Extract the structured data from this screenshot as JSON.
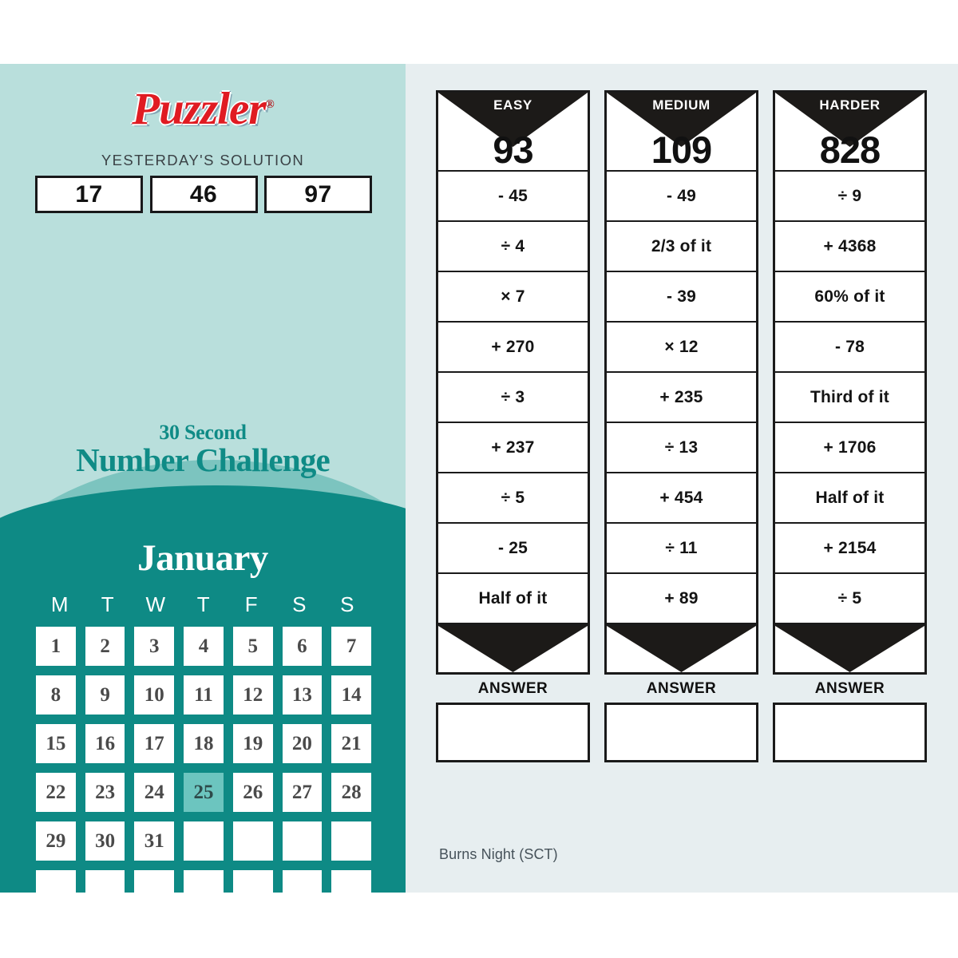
{
  "brand": {
    "logo_text": "Puzzler",
    "registered_mark": "®"
  },
  "yesterday": {
    "label": "YESTERDAY'S SOLUTION",
    "values": [
      "17",
      "46",
      "97"
    ]
  },
  "challenge": {
    "line1": "30 Second",
    "line2": "Number Challenge"
  },
  "calendar": {
    "month": "January",
    "day_headers": [
      "M",
      "T",
      "W",
      "T",
      "F",
      "S",
      "S"
    ],
    "weeks": [
      [
        "1",
        "2",
        "3",
        "4",
        "5",
        "6",
        "7"
      ],
      [
        "8",
        "9",
        "10",
        "11",
        "12",
        "13",
        "14"
      ],
      [
        "15",
        "16",
        "17",
        "18",
        "19",
        "20",
        "21"
      ],
      [
        "22",
        "23",
        "24",
        "25",
        "26",
        "27",
        "28"
      ],
      [
        "29",
        "30",
        "31",
        "",
        "",
        "",
        ""
      ],
      [
        "",
        "",
        "",
        "",
        "",
        "",
        ""
      ]
    ],
    "highlighted_day": "25",
    "highlight_color": "#6cc5bf"
  },
  "puzzles": [
    {
      "difficulty": "EASY",
      "start": "93",
      "steps": [
        "- 45",
        "÷ 4",
        "× 7",
        "+ 270",
        "÷ 3",
        "+ 237",
        "÷ 5",
        "- 25",
        "Half of it"
      ],
      "answer_label": "ANSWER",
      "answer_value": ""
    },
    {
      "difficulty": "MEDIUM",
      "start": "109",
      "steps": [
        "- 49",
        "2/3 of it",
        "- 39",
        "× 12",
        "+ 235",
        "÷ 13",
        "+ 454",
        "÷ 11",
        "+ 89"
      ],
      "answer_label": "ANSWER",
      "answer_value": ""
    },
    {
      "difficulty": "HARDER",
      "start": "828",
      "steps": [
        "÷ 9",
        "+ 4368",
        "60% of it",
        "- 78",
        "Third of it",
        "+ 1706",
        "Half of it",
        "+ 2154",
        "÷ 5"
      ],
      "answer_label": "ANSWER",
      "answer_value": ""
    }
  ],
  "footer": {
    "note": "Burns Night (SCT)"
  },
  "colors": {
    "panel_light_teal": "#b9dfdc",
    "wave_mid_teal": "#7cc4bf",
    "panel_dark_teal": "#0e8a85",
    "content_bg": "#e7eef0",
    "brand_red": "#e01b22",
    "ink": "#1a1a1a"
  }
}
